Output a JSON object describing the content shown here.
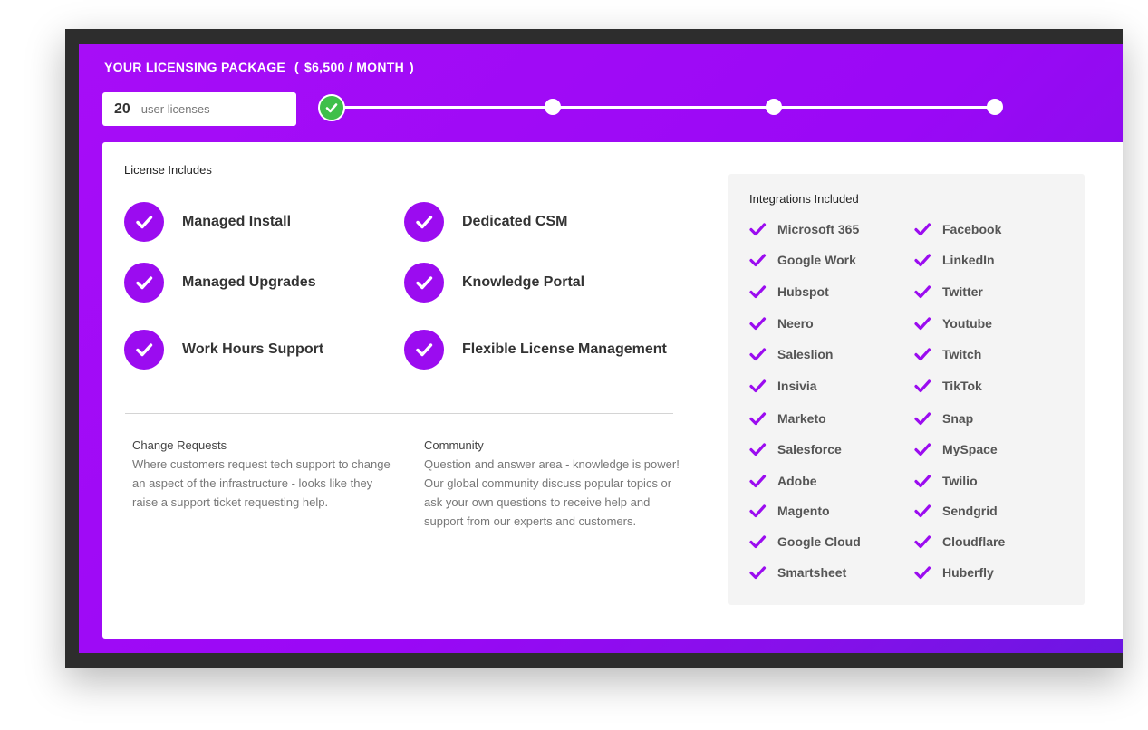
{
  "header": {
    "title": "YOUR LICENSING PACKAGE",
    "paren_open": "(",
    "price": "$6,500 / MONTH",
    "paren_close": ")"
  },
  "license_input": {
    "count": "20",
    "unit": "user licenses"
  },
  "slider": {
    "stops": 4,
    "selected_index": 0
  },
  "license_includes": {
    "title": "License Includes",
    "items": [
      "Managed Install",
      "Dedicated CSM",
      "Managed Upgrades",
      "Knowledge Portal",
      "Work Hours Support",
      "Flexible License Management"
    ]
  },
  "info": {
    "change_requests": {
      "title": "Change Requests",
      "body": "Where customers request tech support to change an aspect of the infrastructure - looks like they raise a support ticket requesting help."
    },
    "community": {
      "title": "Community",
      "body": "Question and answer area - knowledge is power! Our global community discuss popular topics or ask your own questions to receive help and support from our experts and customers."
    }
  },
  "integrations": {
    "title": "Integrations Included",
    "left": [
      "Microsoft 365",
      "Google Work",
      "Hubspot",
      "Neero",
      "Saleslion",
      "Insivia",
      "Marketo",
      "Salesforce",
      "Adobe",
      "Magento",
      "Google Cloud",
      "Smartsheet"
    ],
    "right": [
      "Facebook",
      "LinkedIn",
      "Twitter",
      "Youtube",
      "Twitch",
      "TikTok",
      "Snap",
      "MySpace",
      "Twilio",
      "Sendgrid",
      "Cloudflare",
      "Huberfly"
    ]
  },
  "colors": {
    "accent": "#9b0cf0",
    "slider_selected": "#3fbf4a"
  },
  "icons": {
    "feature_check": "check-circle-icon",
    "integration_check": "check-icon"
  }
}
